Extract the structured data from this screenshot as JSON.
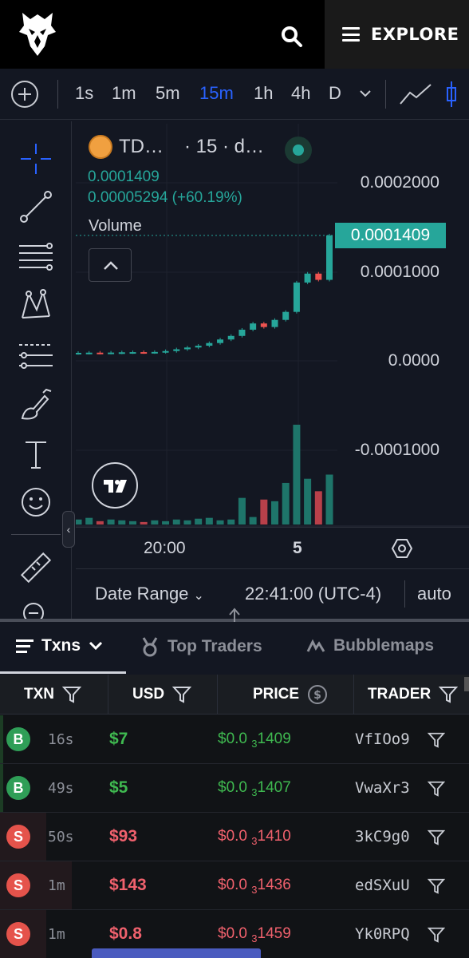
{
  "header": {
    "explore_label": "EXPLORE"
  },
  "toolbar": {
    "intervals": [
      "1s",
      "1m",
      "5m",
      "15m",
      "1h",
      "4h",
      "D"
    ],
    "active_interval": "15m"
  },
  "chart": {
    "symbol": "TD…",
    "interval_suffix": "· 15 · d…",
    "ohlc_price": "0.0001409",
    "change": "0.00005294 (+60.19%)",
    "volume_label": "Volume",
    "last_price": "0.0001409",
    "price_ticks": [
      "0.0002000",
      "0.0001000",
      "0.0000",
      "-0.0001000"
    ],
    "time_ticks": [
      "20:00",
      "5"
    ],
    "date_range_label": "Date Range",
    "clock": "22:41:00 (UTC-4)",
    "scale_mode": "auto",
    "colors": {
      "up": "#26a69a",
      "down": "#ef5350",
      "accent": "#2962ff"
    }
  },
  "chart_data": {
    "type": "line",
    "title": "",
    "xlabel": "",
    "ylabel": "",
    "x_ticks": [
      "20:00",
      "5"
    ],
    "y_ticks": [
      "0.0002000",
      "0.0001000",
      "0.0000",
      "-0.0001000"
    ],
    "ylim": [
      -0.00012,
      0.00024
    ],
    "candles": [
      {
        "o": 8.8e-06,
        "c": 9e-06,
        "up": true
      },
      {
        "o": 9e-06,
        "c": 9.2e-06,
        "up": true
      },
      {
        "o": 9.2e-06,
        "c": 9.1e-06,
        "up": false
      },
      {
        "o": 9.1e-06,
        "c": 9.3e-06,
        "up": true
      },
      {
        "o": 9.3e-06,
        "c": 9.6e-06,
        "up": true
      },
      {
        "o": 9.6e-06,
        "c": 9.8e-06,
        "up": true
      },
      {
        "o": 9.8e-06,
        "c": 9.7e-06,
        "up": false
      },
      {
        "o": 9.7e-06,
        "c": 1e-05,
        "up": true
      },
      {
        "o": 1e-05,
        "c": 1.1e-05,
        "up": true
      },
      {
        "o": 1.1e-05,
        "c": 1.3e-05,
        "up": true
      },
      {
        "o": 1.3e-05,
        "c": 1.5e-05,
        "up": true
      },
      {
        "o": 1.5e-05,
        "c": 1.7e-05,
        "up": true
      },
      {
        "o": 1.7e-05,
        "c": 2e-05,
        "up": true
      },
      {
        "o": 2e-05,
        "c": 2.4e-05,
        "up": true
      },
      {
        "o": 2.4e-05,
        "c": 2.8e-05,
        "up": true
      },
      {
        "o": 2.8e-05,
        "c": 3.5e-05,
        "up": true
      },
      {
        "o": 3.5e-05,
        "c": 4.2e-05,
        "up": true
      },
      {
        "o": 4.2e-05,
        "c": 3.8e-05,
        "up": false
      },
      {
        "o": 3.8e-05,
        "c": 4.6e-05,
        "up": true
      },
      {
        "o": 4.6e-05,
        "c": 5.5e-05,
        "up": true
      },
      {
        "o": 5.5e-05,
        "c": 8.8e-05,
        "up": true
      },
      {
        "o": 8.8e-05,
        "c": 9.8e-05,
        "up": true
      },
      {
        "o": 9.8e-05,
        "c": 9.1e-05,
        "up": false
      },
      {
        "o": 9.1e-05,
        "c": 0.0001409,
        "up": true
      }
    ],
    "volume": [
      6,
      8,
      4,
      6,
      5,
      4,
      3,
      5,
      4,
      6,
      5,
      7,
      8,
      5,
      6,
      32,
      9,
      30,
      28,
      50,
      120,
      55,
      40,
      60
    ],
    "volume_up": [
      true,
      true,
      false,
      true,
      true,
      true,
      false,
      true,
      true,
      true,
      true,
      true,
      true,
      true,
      true,
      true,
      true,
      false,
      true,
      true,
      true,
      true,
      false,
      true
    ]
  },
  "tabs": [
    {
      "label": "Txns",
      "active": true
    },
    {
      "label": "Top Traders",
      "active": false
    },
    {
      "label": "Bubblemaps",
      "active": false
    }
  ],
  "table": {
    "headers": [
      "TXN",
      "USD",
      "PRICE",
      "TRADER"
    ],
    "rows": [
      {
        "type": "B",
        "age": "16s",
        "usd": "$7",
        "price_prefix": "$0.0",
        "price_sub": "3",
        "price_tail": "1409",
        "trader": "VfIOo9",
        "side": "buy"
      },
      {
        "type": "B",
        "age": "49s",
        "usd": "$5",
        "price_prefix": "$0.0",
        "price_sub": "3",
        "price_tail": "1407",
        "trader": "VwaXr3",
        "side": "buy"
      },
      {
        "type": "S",
        "age": "50s",
        "usd": "$93",
        "price_prefix": "$0.0",
        "price_sub": "3",
        "price_tail": "1410",
        "trader": "3kC9g0",
        "side": "sell"
      },
      {
        "type": "S",
        "age": "1m",
        "usd": "$143",
        "price_prefix": "$0.0",
        "price_sub": "3",
        "price_tail": "1436",
        "trader": "edSXuU",
        "side": "sell"
      },
      {
        "type": "S",
        "age": "1m",
        "usd": "$0.8",
        "price_prefix": "$0.0",
        "price_sub": "3",
        "price_tail": "1459",
        "trader": "Yk0RPQ",
        "side": "sell"
      }
    ]
  }
}
